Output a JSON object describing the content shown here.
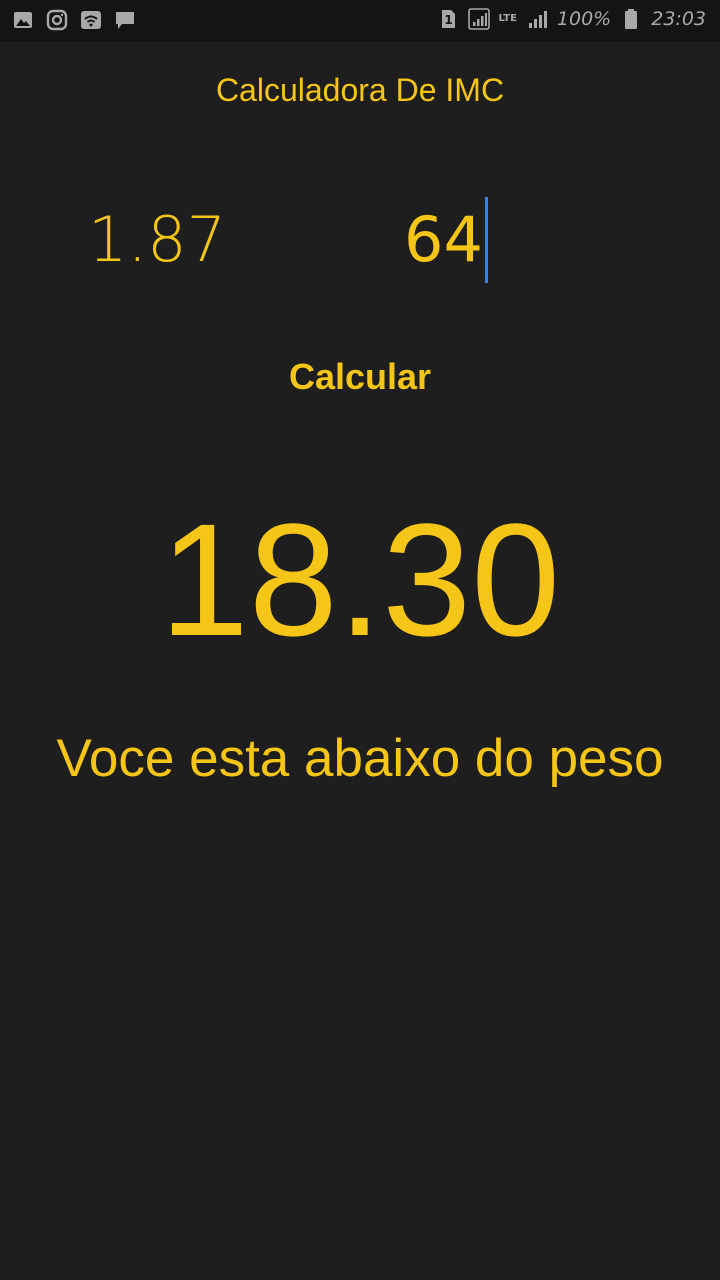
{
  "status_bar": {
    "battery_text": "100%",
    "time": "23:03",
    "sim_label": "1",
    "network_label": "LTE",
    "icons_left": [
      "gallery-icon",
      "instagram-icon",
      "wifi-icon",
      "message-icon"
    ],
    "icons_right": [
      "sim-icon",
      "signal-icon",
      "lte-signal-icon",
      "battery-icon"
    ]
  },
  "app": {
    "title": "Calculadora De IMC",
    "height_value": "1.87",
    "weight_value": "64",
    "calculate_label": "Calcular",
    "result_value": "18.30",
    "result_message": "Voce esta abaixo do peso"
  },
  "colors": {
    "background": "#1e1e1e",
    "status_bar": "#141414",
    "accent": "#f5c518",
    "caret": "#2f86e0"
  }
}
